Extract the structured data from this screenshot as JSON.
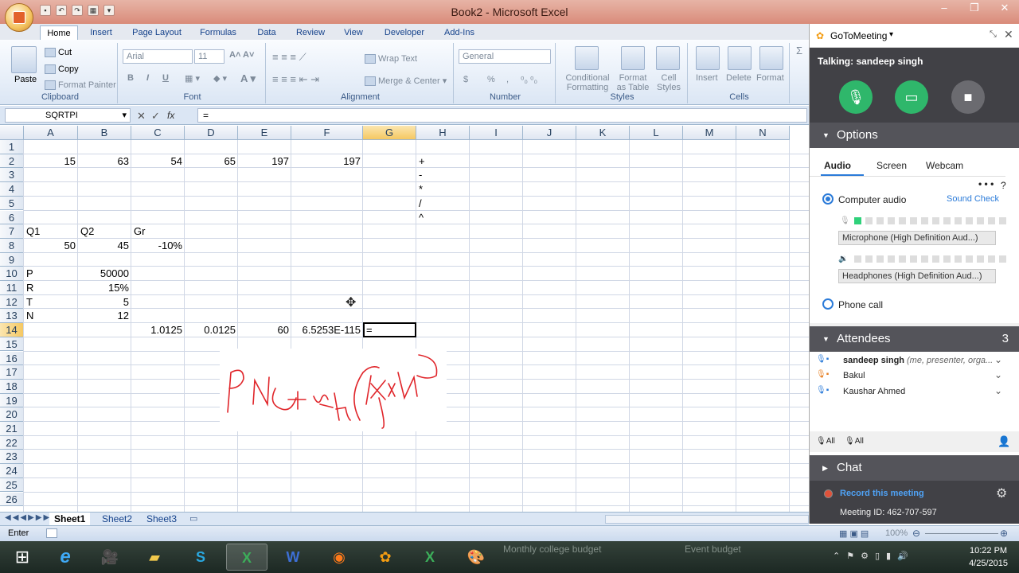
{
  "window": {
    "title": "Book2 - Microsoft Excel",
    "controls": [
      "‒",
      "❐",
      "✕"
    ]
  },
  "ribbon_tabs": [
    "Home",
    "Insert",
    "Page Layout",
    "Formulas",
    "Data",
    "Review",
    "View",
    "Developer",
    "Add-Ins"
  ],
  "ribbon": {
    "clipboard": {
      "label": "Clipboard",
      "paste": "Paste",
      "cut": "Cut",
      "copy": "Copy",
      "format_painter": "Format Painter"
    },
    "font": {
      "label": "Font",
      "font_name": "Arial",
      "font_size": "11",
      "bold": "B",
      "italic": "I",
      "underline": "U"
    },
    "alignment": {
      "label": "Alignment",
      "wrap_text": "Wrap Text",
      "merge_center": "Merge & Center"
    },
    "number": {
      "label": "Number",
      "format": "General",
      "currency": "$",
      "percent": "%",
      "comma": ","
    },
    "styles": {
      "label": "Styles",
      "conditional": "Conditional",
      "conditional2": "Formatting",
      "format_table": "Format",
      "format_table2": "as Table",
      "cell_styles": "Cell",
      "cell_styles2": "Styles"
    },
    "cells": {
      "label": "Cells",
      "insert": "Insert",
      "delete": "Delete",
      "format": "Format"
    }
  },
  "formula_bar": {
    "name_box": "SQRTPI",
    "fx": "fx",
    "content": "="
  },
  "columns": [
    "A",
    "B",
    "C",
    "D",
    "E",
    "F",
    "G",
    "H",
    "I",
    "J",
    "K",
    "L",
    "M",
    "N"
  ],
  "rows": [
    "1",
    "2",
    "3",
    "4",
    "5",
    "6",
    "7",
    "8",
    "9",
    "10",
    "11",
    "12",
    "13",
    "14",
    "15",
    "16",
    "17",
    "18",
    "19",
    "20",
    "21",
    "22",
    "23",
    "24",
    "25",
    "26"
  ],
  "cells": {
    "A2": "15",
    "B2": "63",
    "C2": "54",
    "D2": "65",
    "E2": "197",
    "F2": "197",
    "H2": "+",
    "H3": "-",
    "H4": "*",
    "H5": "/",
    "H6": "^",
    "A7": "Q1",
    "B7": "Q2",
    "C7": "Gr",
    "A8": "50",
    "B8": "45",
    "C8": "-10%",
    "A10": "P",
    "B10": "50000",
    "A11": "R",
    "B11": "15%",
    "A12": "T",
    "B12": "5",
    "A13": "N",
    "B13": "12",
    "C14": "1.0125",
    "D14": "0.0125",
    "E14": "60",
    "F14": "6.5253E-115",
    "G14": "="
  },
  "sheets": [
    "Sheet1",
    "Sheet2",
    "Sheet3"
  ],
  "status": {
    "mode": "Enter",
    "zoom": "100%"
  },
  "gotomeeting": {
    "app_name": "GoToMeeting",
    "talking": "Talking: sandeep singh",
    "options": "Options",
    "tabs": [
      "Audio",
      "Screen",
      "Webcam"
    ],
    "computer_audio": "Computer audio",
    "sound_check": "Sound Check",
    "microphone": "Microphone (High Definition Aud...)",
    "headphones": "Headphones (High Definition Aud...)",
    "phone_call": "Phone call",
    "attendees_label": "Attendees",
    "attendees_count": "3",
    "attendees": [
      {
        "name": "sandeep singh",
        "role": "(me, presenter, orga..."
      },
      {
        "name": "Bakul",
        "role": ""
      },
      {
        "name": "Kaushar Ahmed",
        "role": ""
      }
    ],
    "mute_all": "All",
    "unmute_all": "All",
    "chat": "Chat",
    "record": "Record this meeting",
    "meeting_id": "Meeting ID: 462-707-597",
    "colors": {
      "talk_bg": "#414146",
      "green": "#2fb76b",
      "record": "#2b7bd9"
    }
  },
  "taskbar": {
    "time": "10:22 PM",
    "date": "4/25/2015",
    "ghost_text_1": "Monthly college budget",
    "ghost_text_2": "Event budget"
  }
}
